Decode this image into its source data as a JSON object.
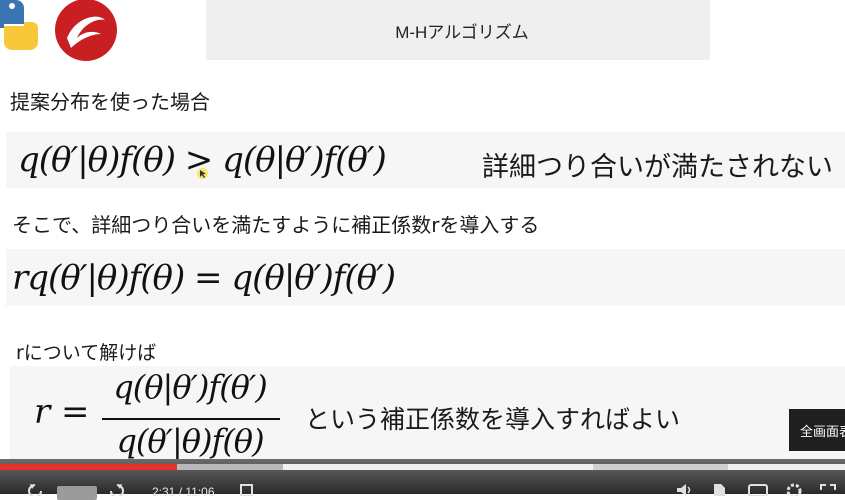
{
  "header": {
    "title": "M-Hアルゴリズム",
    "logos": [
      "python-logo",
      "red-swirl-logo"
    ]
  },
  "content": {
    "caption1": "提案分布を使った場合",
    "equation1": "q(θ′|θ)f(θ) > q(θ|θ′)f(θ′)",
    "note1": "詳細つり合いが満たされない",
    "caption2": "そこで、詳細つり合いを満たすように補正係数rを導入する",
    "equation2": "rq(θ′|θ)f(θ) = q(θ|θ′)f(θ′)",
    "caption3": "rについて解けば",
    "equation3": {
      "lhs": "r =",
      "numerator": "q(θ|θ′)f(θ′)",
      "denominator": "q(θ′|θ)f(θ)"
    },
    "note3": "という補正係数を導入すればよい"
  },
  "tooltip": "全画面表",
  "player": {
    "progress_played": 0.21,
    "time": "2:31 / 11:06",
    "speed": "1"
  },
  "colors": {
    "progress": "#e8302c",
    "title_bg": "#efefef",
    "math_bg": "#f6f6f6"
  }
}
